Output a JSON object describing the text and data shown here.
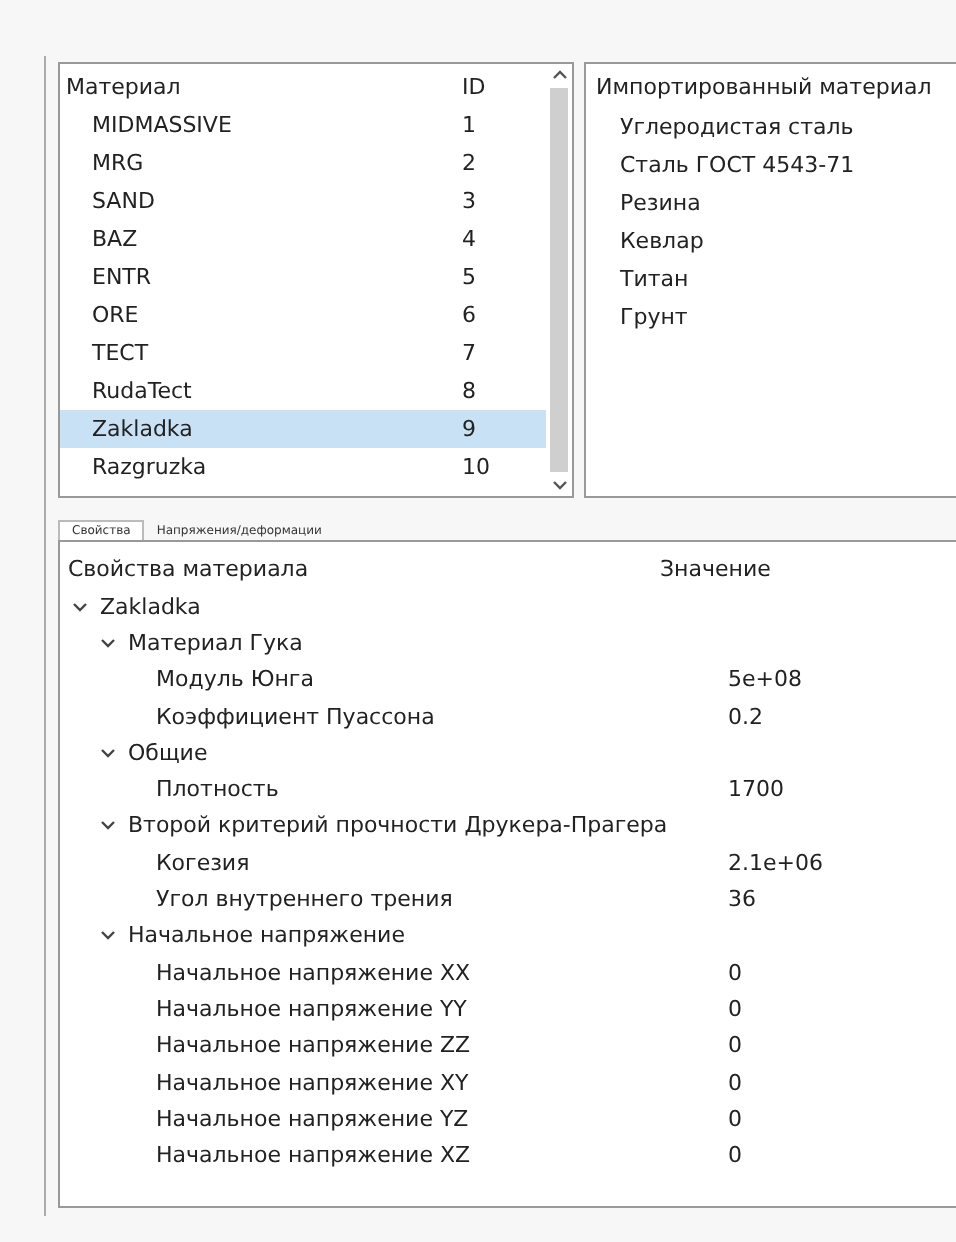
{
  "materials": {
    "columns": [
      "Материал",
      "ID"
    ],
    "rows": [
      {
        "name": "MIDMASSIVE",
        "id": "1",
        "selected": false
      },
      {
        "name": "MRG",
        "id": "2",
        "selected": false
      },
      {
        "name": "SAND",
        "id": "3",
        "selected": false
      },
      {
        "name": "BAZ",
        "id": "4",
        "selected": false
      },
      {
        "name": "ENTR",
        "id": "5",
        "selected": false
      },
      {
        "name": "ORE",
        "id": "6",
        "selected": false
      },
      {
        "name": "TECT",
        "id": "7",
        "selected": false
      },
      {
        "name": "RudaTect",
        "id": "8",
        "selected": false
      },
      {
        "name": "Zakladka",
        "id": "9",
        "selected": true
      },
      {
        "name": "Razgruzka",
        "id": "10",
        "selected": false
      }
    ]
  },
  "imported": {
    "heading": "Импортированный материал",
    "items": [
      "Углеродистая сталь",
      "Сталь ГОСТ 4543-71",
      "Резина",
      "Кевлар",
      "Титан",
      "Грунт"
    ]
  },
  "tabs": [
    {
      "label": "Свойства",
      "selected": true
    },
    {
      "label": "Напряжения/деформации",
      "selected": false
    }
  ],
  "properties": {
    "columns": [
      "Свойства материала",
      "Значение"
    ],
    "tree": [
      {
        "label": "Zakladka",
        "expanded": true,
        "children": [
          {
            "label": "Материал Гука",
            "expanded": true,
            "children": [
              {
                "label": "Модуль Юнга",
                "value": "5e+08"
              },
              {
                "label": "Коэффициент Пуассона",
                "value": "0.2"
              }
            ]
          },
          {
            "label": "Общие",
            "expanded": true,
            "children": [
              {
                "label": "Плотность",
                "value": "1700"
              }
            ]
          },
          {
            "label": "Второй критерий прочности Друкера-Прагера",
            "expanded": true,
            "children": [
              {
                "label": "Когезия",
                "value": "2.1e+06"
              },
              {
                "label": "Угол внутреннего трения",
                "value": "36"
              }
            ]
          },
          {
            "label": "Начальное напряжение",
            "expanded": true,
            "children": [
              {
                "label": "Начальное напряжение XX",
                "value": "0"
              },
              {
                "label": "Начальное напряжение YY",
                "value": "0"
              },
              {
                "label": "Начальное напряжение ZZ",
                "value": "0"
              },
              {
                "label": "Начальное напряжение XY",
                "value": "0"
              },
              {
                "label": "Начальное напряжение YZ",
                "value": "0"
              },
              {
                "label": "Начальное напряжение XZ",
                "value": "0"
              }
            ]
          }
        ]
      }
    ]
  }
}
